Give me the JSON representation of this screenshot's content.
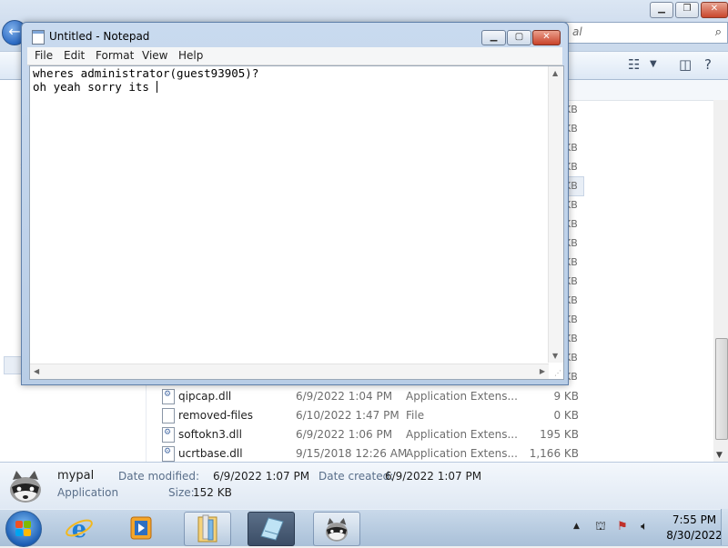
{
  "explorer": {
    "search_placeholder": "al",
    "kb_suffix": "KB",
    "files": [
      {
        "name": "qipcap.dll",
        "date": "6/9/2022 1:04 PM",
        "type": "Application Extens...",
        "size": "9 KB",
        "icon": "dll-file-icon"
      },
      {
        "name": "removed-files",
        "date": "6/10/2022 1:47 PM",
        "type": "File",
        "size": "0 KB",
        "icon": "file-icon"
      },
      {
        "name": "softokn3.dll",
        "date": "6/9/2022 1:06 PM",
        "type": "Application Extens...",
        "size": "195 KB",
        "icon": "dll-file-icon"
      },
      {
        "name": "ucrtbase.dll",
        "date": "9/15/2018 12:26 AM",
        "type": "Application Extens...",
        "size": "1,166 KB",
        "icon": "dll-file-icon"
      }
    ],
    "details": {
      "name": "mypal",
      "kind": "Application",
      "modified_label": "Date modified:",
      "modified_value": "6/9/2022 1:07 PM",
      "created_label": "Date created:",
      "created_value": "6/9/2022 1:07 PM",
      "size_label": "Size:",
      "size_value": "152 KB"
    }
  },
  "notepad": {
    "title": "Untitled - Notepad",
    "menu": [
      "File",
      "Edit",
      "Format",
      "View",
      "Help"
    ],
    "lines": [
      "wheres administrator(guest93905)?",
      "oh yeah sorry its "
    ]
  },
  "taskbar": {
    "time": "7:55 PM",
    "date": "8/30/2022"
  }
}
